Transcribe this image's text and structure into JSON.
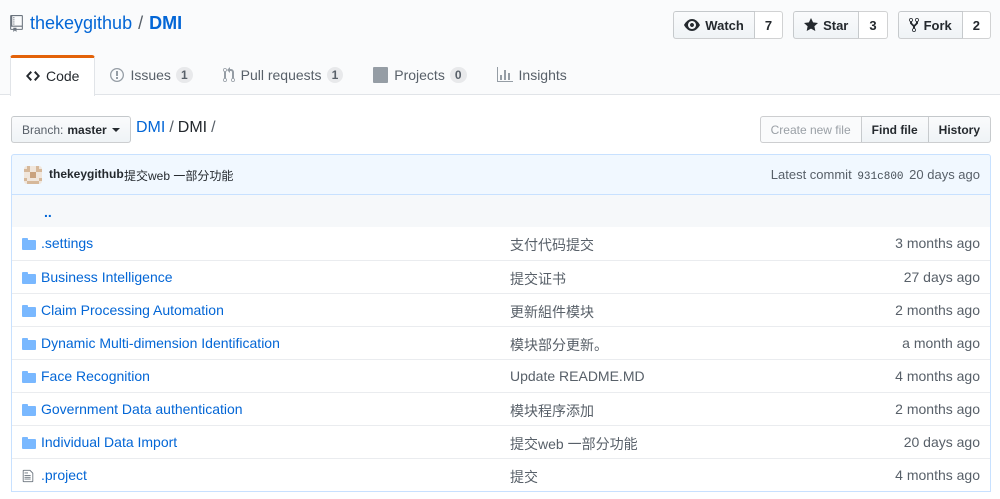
{
  "repo": {
    "owner": "thekeygithub",
    "separator": "/",
    "name": "DMI"
  },
  "actions": {
    "watch": {
      "label": "Watch",
      "count": "7"
    },
    "star": {
      "label": "Star",
      "count": "3"
    },
    "fork": {
      "label": "Fork",
      "count": "2"
    }
  },
  "tabs": [
    {
      "label": "Code",
      "counter": ""
    },
    {
      "label": "Issues",
      "counter": "1"
    },
    {
      "label": "Pull requests",
      "counter": "1"
    },
    {
      "label": "Projects",
      "counter": "0"
    },
    {
      "label": "Insights",
      "counter": ""
    }
  ],
  "branch": {
    "label": "Branch:",
    "name": "master"
  },
  "breadcrumb": {
    "root": "DMI",
    "sep": "/",
    "current": "DMI",
    "trail": "/"
  },
  "file_buttons": {
    "create": "Create new file",
    "find": "Find file",
    "history": "History"
  },
  "commit": {
    "author": "thekeygithub",
    "message": "提交web 一部分功能",
    "latest_label": "Latest commit",
    "sha": "931c800",
    "age": "20 days ago"
  },
  "up_dir": "..",
  "files": [
    {
      "type": "dir",
      "name": ".settings",
      "message": "支付代码提交",
      "age": "3 months ago"
    },
    {
      "type": "dir",
      "name": "Business Intelligence",
      "message": "提交证书",
      "age": "27 days ago"
    },
    {
      "type": "dir",
      "name": "Claim Processing Automation",
      "message": "更新組件模块",
      "age": "2 months ago"
    },
    {
      "type": "dir",
      "name": "Dynamic Multi-dimension Identification",
      "message": "模块部分更新。",
      "age": "a month ago"
    },
    {
      "type": "dir",
      "name": "Face Recognition",
      "message": "Update README.MD",
      "age": "4 months ago"
    },
    {
      "type": "dir",
      "name": "Government Data authentication",
      "message": "模块程序添加",
      "age": "2 months ago"
    },
    {
      "type": "dir",
      "name": "Individual Data Import",
      "message": "提交web 一部分功能",
      "age": "20 days ago"
    },
    {
      "type": "file",
      "name": ".project",
      "message": "提交",
      "age": "4 months ago"
    }
  ],
  "colors": {
    "link": "#0366d6",
    "tab_accent": "#e36209",
    "commit_bg": "#f1f8ff",
    "folder": "#79b8ff"
  }
}
